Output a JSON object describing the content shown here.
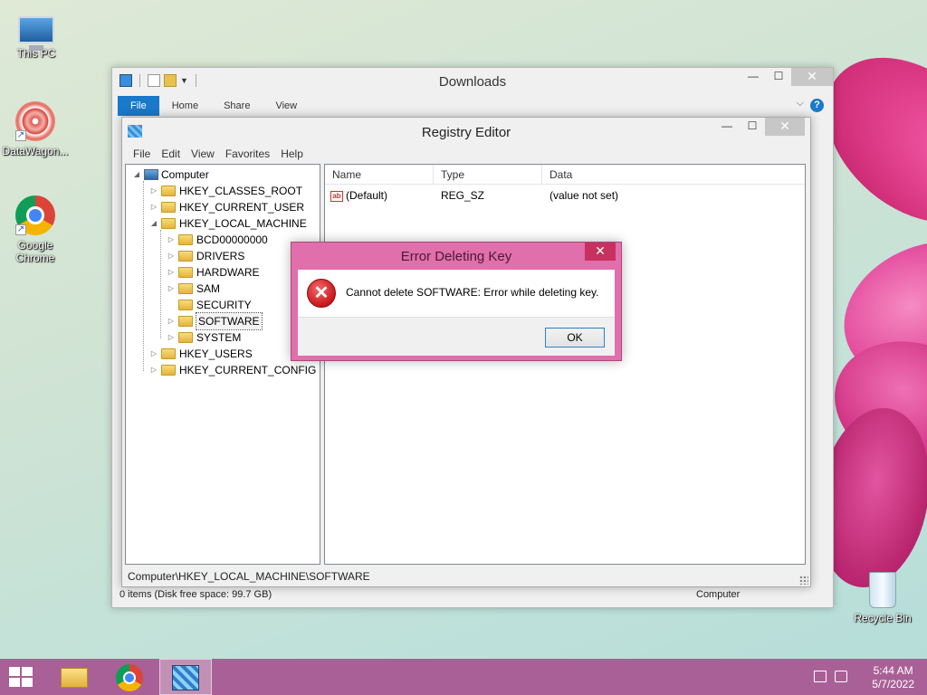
{
  "desktop": {
    "icons": [
      {
        "label": "This PC"
      },
      {
        "label": "DataWagon..."
      },
      {
        "label": "Google Chrome"
      },
      {
        "label": "Recycle Bin"
      }
    ]
  },
  "explorer": {
    "title": "Downloads",
    "tabs": [
      "File",
      "Home",
      "Share",
      "View"
    ],
    "status_left": "0 items (Disk free space: 99.7 GB)",
    "status_right": "Computer",
    "help": "?"
  },
  "regedit": {
    "title": "Registry Editor",
    "menu": [
      "File",
      "Edit",
      "View",
      "Favorites",
      "Help"
    ],
    "tree": {
      "root": "Computer",
      "hives": [
        "HKEY_CLASSES_ROOT",
        "HKEY_CURRENT_USER",
        "HKEY_LOCAL_MACHINE",
        "HKEY_USERS",
        "HKEY_CURRENT_CONFIG"
      ],
      "hklm_children": [
        "BCD00000000",
        "DRIVERS",
        "HARDWARE",
        "SAM",
        "SECURITY",
        "SOFTWARE",
        "SYSTEM"
      ],
      "selected": "SOFTWARE"
    },
    "columns": [
      "Name",
      "Type",
      "Data"
    ],
    "rows": [
      {
        "name": "(Default)",
        "type": "REG_SZ",
        "data": "(value not set)",
        "icon": "ab"
      }
    ],
    "status": "Computer\\HKEY_LOCAL_MACHINE\\SOFTWARE"
  },
  "dialog": {
    "title": "Error Deleting Key",
    "message": "Cannot delete SOFTWARE:  Error while deleting key.",
    "ok_label": "OK",
    "error_glyph": "✕"
  },
  "taskbar": {
    "time": "5:44 AM",
    "date": "5/7/2022"
  },
  "colors": {
    "taskbar": "#a96096",
    "dialog_frame": "#e06fab",
    "file_tab": "#1979ca"
  }
}
